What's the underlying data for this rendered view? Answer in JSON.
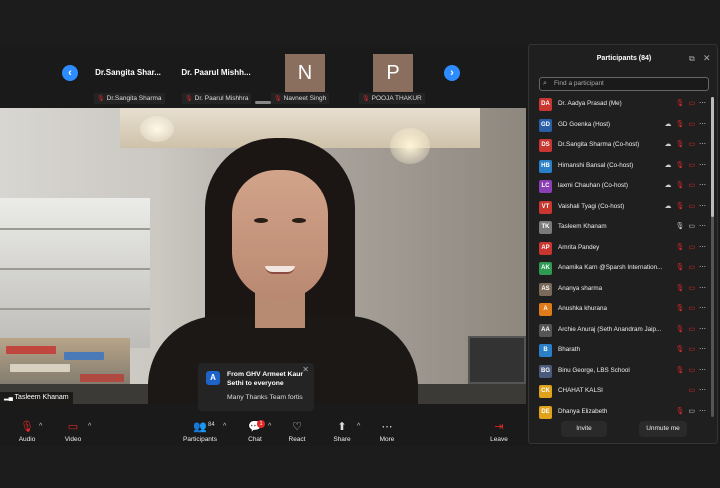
{
  "strip": {
    "thumbs": [
      {
        "name": "Dr.Sangita  Shar...",
        "label": "Dr.Sangita Sharma"
      },
      {
        "name": "Dr. Paarul  Mishh...",
        "label": "Dr. Paarul Mishhra"
      },
      {
        "initial": "N",
        "label": "Navneet Singh"
      },
      {
        "initial": "P",
        "label": "POOJA THAKUR"
      }
    ]
  },
  "video": {
    "speaker_name": "Tasleem Khanam"
  },
  "toast": {
    "avatar": "A",
    "title": "From GHV Armeet Kaur Sethi to everyone",
    "message": "Many Thanks Team fortis"
  },
  "toolbar": {
    "audio": "Audio",
    "video": "Video",
    "participants": "Participants",
    "participants_count": "84",
    "chat": "Chat",
    "chat_badge": "1",
    "react": "React",
    "share": "Share",
    "more": "More",
    "leave": "Leave"
  },
  "panel": {
    "title": "Participants (84)",
    "search_placeholder": "Find a participant",
    "invite": "Invite",
    "unmute_me": "Unmute me",
    "participants": [
      {
        "initials": "DA",
        "color": "#c8362f",
        "name": "Dr. Aadya Prasad (Me)"
      },
      {
        "initials": "GD",
        "color": "#2a5ea8",
        "name": "GD Goenka (Host)"
      },
      {
        "initials": "DS",
        "color": "#c8362f",
        "name": "Dr.Sangita Sharma (Co-host)"
      },
      {
        "initials": "HB",
        "color": "#2a7fc6",
        "name": "Himanshi Bansal (Co-host)"
      },
      {
        "initials": "LC",
        "color": "#8a3fb5",
        "name": "laxmi Chauhan (Co-host)"
      },
      {
        "initials": "VT",
        "color": "#c8362f",
        "name": "Vaishali Tyagi (Co-host)"
      },
      {
        "initials": "TK",
        "color": "#7a7a7a",
        "name": "Tasleem Khanam"
      },
      {
        "initials": "AP",
        "color": "#c8362f",
        "name": "Amrita Pandey"
      },
      {
        "initials": "AK",
        "color": "#2e9a52",
        "name": "Anamika Karn @Sparsh Internation..."
      },
      {
        "initials": "AS",
        "color": "#7a6a5a",
        "name": "Ananya sharma"
      },
      {
        "initials": "A",
        "color": "#e07b1a",
        "name": "Anushka khurana"
      },
      {
        "initials": "AA",
        "color": "#555555",
        "name": "Archie Anuraj (Seth Anandram Jaip..."
      },
      {
        "initials": "B",
        "color": "#2a7fc6",
        "name": "Bharath"
      },
      {
        "initials": "BG",
        "color": "#4a5a7a",
        "name": "Binu George, LBS School"
      },
      {
        "initials": "CK",
        "color": "#e0a21a",
        "name": "CHAHAT KALSI"
      },
      {
        "initials": "DE",
        "color": "#e0a21a",
        "name": "Dhanya Elizabeth"
      }
    ]
  }
}
